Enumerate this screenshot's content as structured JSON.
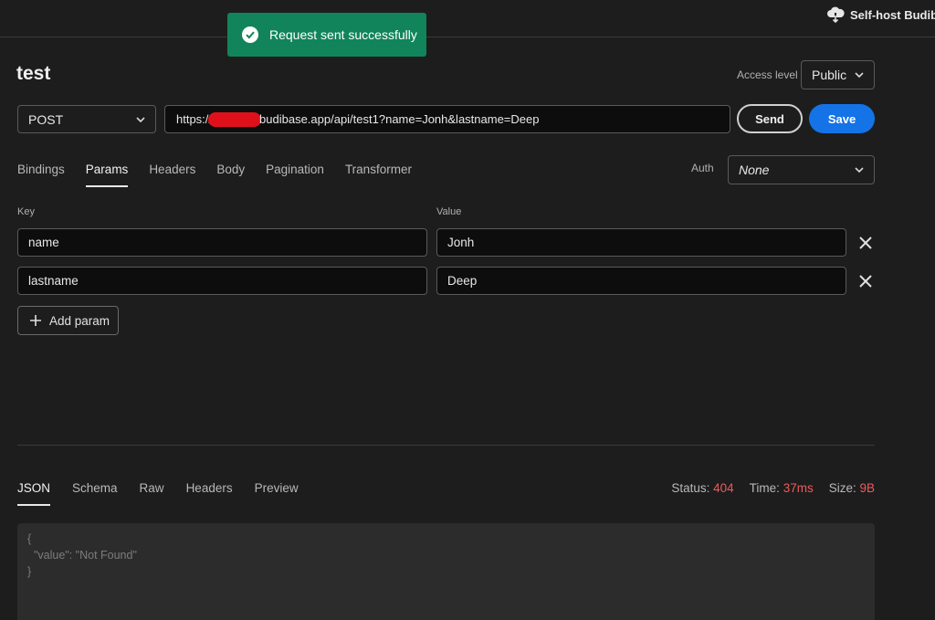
{
  "topbar": {
    "selfhost_label": "Self-host Budib"
  },
  "toast": {
    "message": "Request sent successfully"
  },
  "query": {
    "title": "test",
    "access_label": "Access level",
    "access_value": "Public",
    "method": "POST",
    "url_prefix": "https://",
    "url_suffix": "budibase.app/api/test1?name=Jonh&lastname=Deep",
    "send_label": "Send",
    "save_label": "Save"
  },
  "request_tabs": [
    {
      "label": "Bindings",
      "active": false
    },
    {
      "label": "Params",
      "active": true
    },
    {
      "label": "Headers",
      "active": false
    },
    {
      "label": "Body",
      "active": false
    },
    {
      "label": "Pagination",
      "active": false
    },
    {
      "label": "Transformer",
      "active": false
    }
  ],
  "auth": {
    "label": "Auth",
    "value": "None"
  },
  "params": {
    "key_header": "Key",
    "value_header": "Value",
    "rows": [
      {
        "key": "name",
        "value": "Jonh"
      },
      {
        "key": "lastname",
        "value": "Deep"
      }
    ],
    "add_label": "Add param"
  },
  "response_tabs": [
    {
      "label": "JSON",
      "active": true
    },
    {
      "label": "Schema",
      "active": false
    },
    {
      "label": "Raw",
      "active": false
    },
    {
      "label": "Headers",
      "active": false
    },
    {
      "label": "Preview",
      "active": false
    }
  ],
  "response_stats": {
    "status_label": "Status:",
    "status_value": "404",
    "time_label": "Time:",
    "time_value": "37ms",
    "size_label": "Size:",
    "size_value": "9B"
  },
  "response_body": {
    "line1": "{",
    "line2": "  \"value\": \"Not Found\"",
    "line3": "}"
  },
  "colors": {
    "background": "#1d1d1d",
    "toast": "#11845c",
    "primary": "#1473e6",
    "error": "#ec5b5b"
  }
}
